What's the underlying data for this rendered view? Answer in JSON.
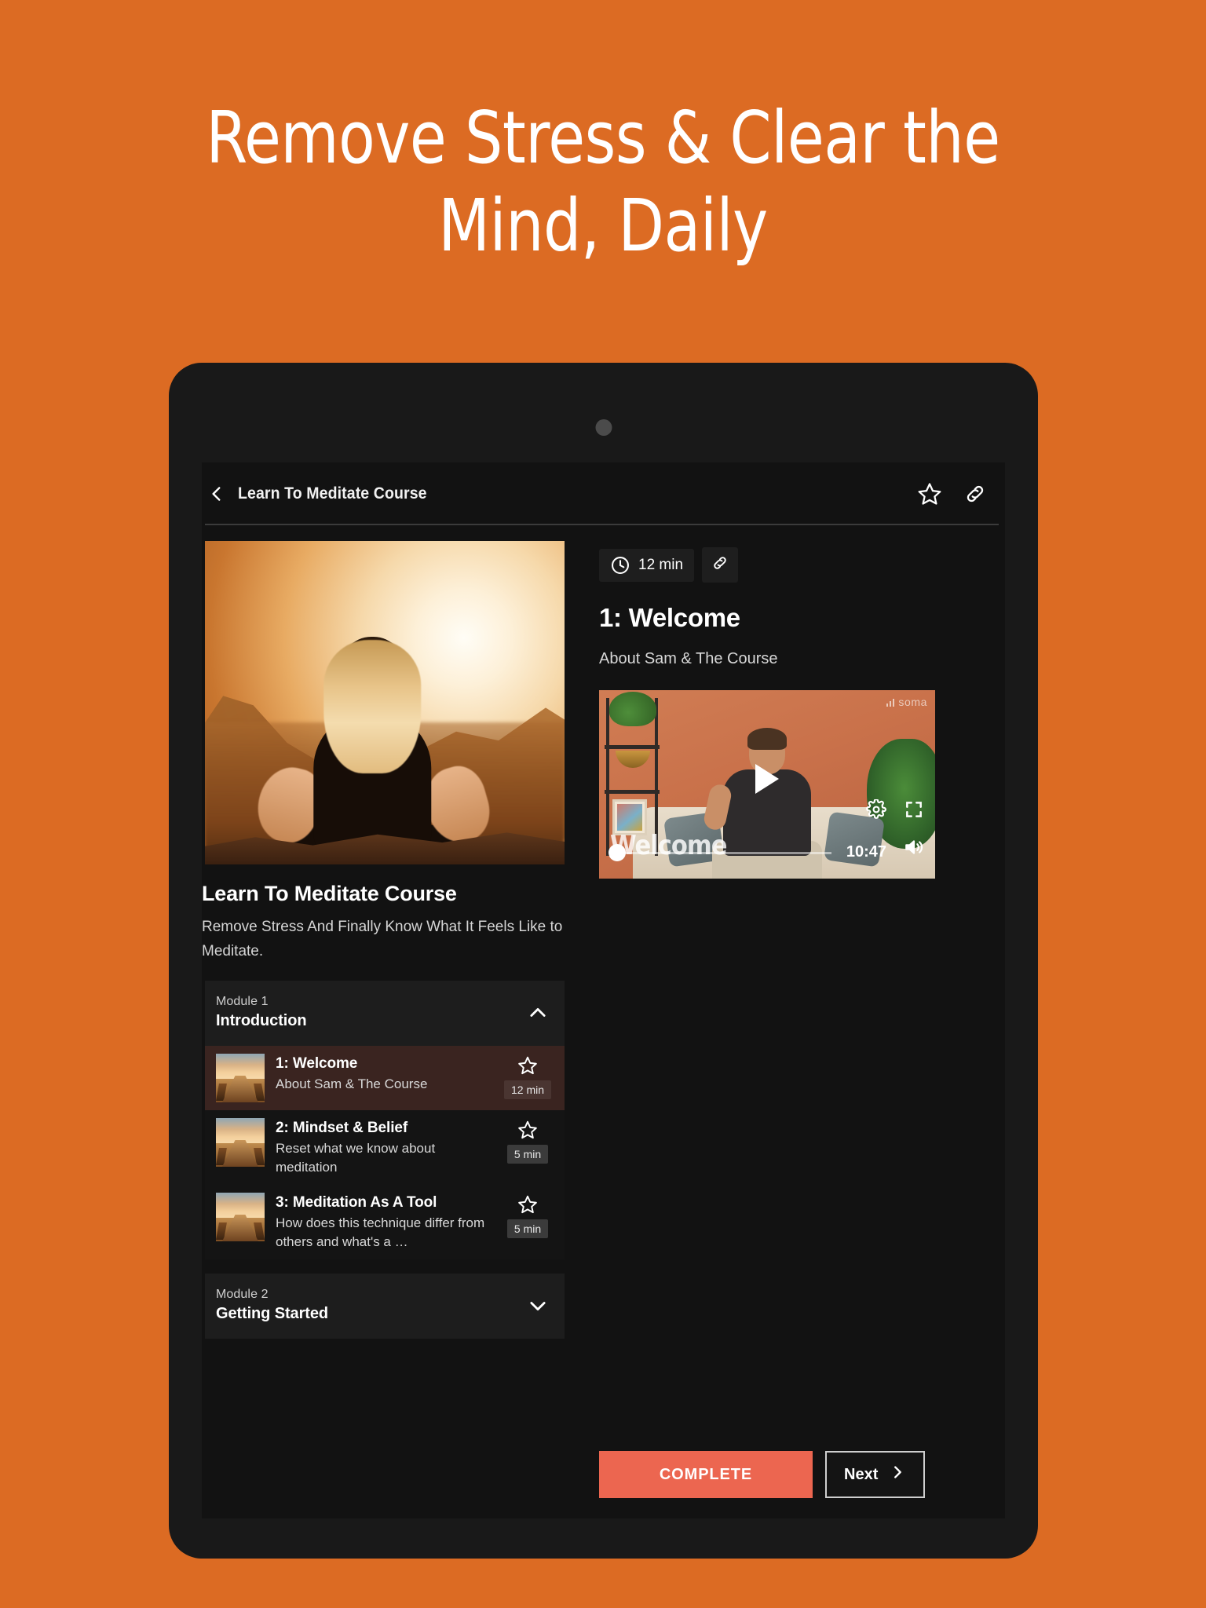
{
  "promo": {
    "headline": "Remove Stress & Clear the Mind, Daily"
  },
  "colors": {
    "background": "#DC6B23",
    "device_frame": "#191919",
    "app_background": "#121212",
    "accent_complete": "#EC6650",
    "active_row": "#3A2420"
  },
  "header": {
    "back_icon": "chevron-left-icon",
    "title": "Learn To Meditate Course",
    "favorite_icon": "star-icon",
    "share_icon": "link-icon"
  },
  "course": {
    "title": "Learn To Meditate Course",
    "subtitle": "Remove Stress And Finally Know What It Feels Like to Meditate.",
    "hero_alt": "woman-meditating-at-sunset"
  },
  "modules": [
    {
      "kicker": "Module 1",
      "name": "Introduction",
      "expanded": true,
      "chevron_icon": "chevron-up-icon",
      "lessons": [
        {
          "title": "1: Welcome",
          "description": "About Sam & The Course",
          "duration": "12 min",
          "star_icon": "star-icon",
          "active": true
        },
        {
          "title": "2: Mindset & Belief",
          "description": "Reset what we know about meditation",
          "duration": "5 min",
          "star_icon": "star-icon",
          "active": false
        },
        {
          "title": "3: Meditation As A Tool",
          "description": "How does this technique differ from others and what's a …",
          "duration": "5 min",
          "star_icon": "star-icon",
          "active": false
        }
      ]
    },
    {
      "kicker": "Module 2",
      "name": "Getting Started",
      "expanded": false,
      "chevron_icon": "chevron-down-icon",
      "lessons": []
    }
  ],
  "detail": {
    "duration": "12 min",
    "clock_icon": "clock-icon",
    "link_icon": "link-icon",
    "title": "1: Welcome",
    "subtitle": "About Sam & The Course",
    "player": {
      "watermark": "soma",
      "signal_icon": "signal-bars-icon",
      "play_icon": "play-icon",
      "caption": "Welcome",
      "time_remaining": "10:47",
      "settings_icon": "gear-icon",
      "fullscreen_icon": "fullscreen-icon",
      "volume_icon": "volume-icon",
      "progress_percent": 3
    }
  },
  "actions": {
    "complete_label": "COMPLETE",
    "next_label": "Next",
    "next_icon": "chevron-right-icon"
  }
}
